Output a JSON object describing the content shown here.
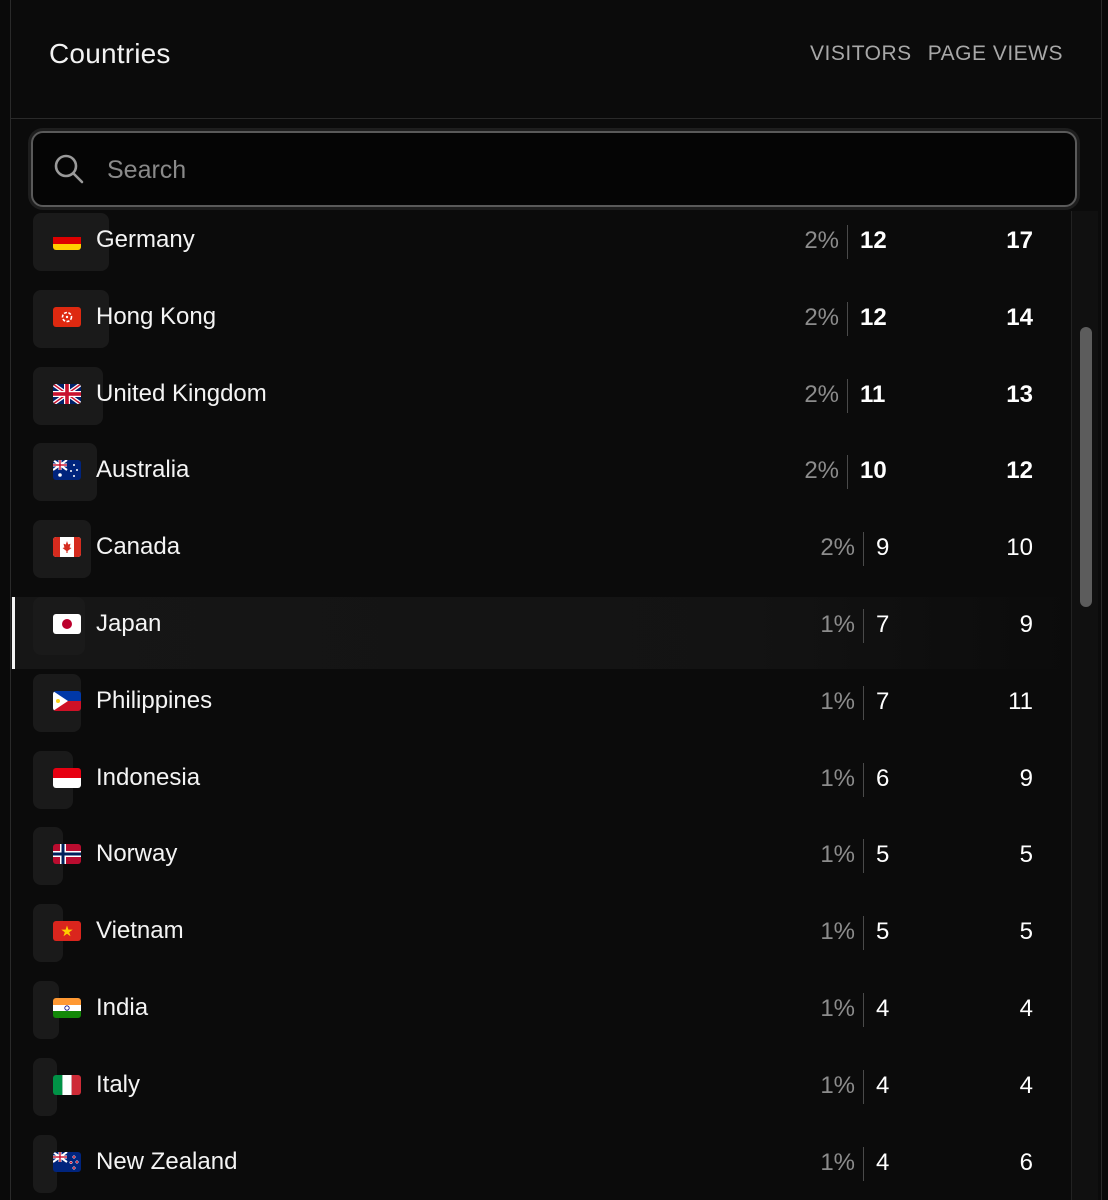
{
  "panel": {
    "title": "Countries",
    "columns": [
      "VISITORS",
      "PAGE VIEWS"
    ]
  },
  "search": {
    "placeholder": "Search",
    "value": ""
  },
  "colors": {
    "background": "#0b0b0b",
    "row_bar": "#1a1a1a",
    "text": "#f4f4f4",
    "muted": "#8c8c8c"
  },
  "rows": [
    {
      "country": "Germany",
      "flag": "germany-flag-icon",
      "percent": "2%",
      "percent_value": 2,
      "visitors": "12",
      "page_views": "17",
      "highlighted": false
    },
    {
      "country": "Hong Kong",
      "flag": "hong-kong-flag-icon",
      "percent": "2%",
      "percent_value": 2,
      "visitors": "12",
      "page_views": "14",
      "highlighted": false
    },
    {
      "country": "United Kingdom",
      "flag": "united-kingdom-flag-icon",
      "percent": "2%",
      "percent_value": 2,
      "visitors": "11",
      "page_views": "13",
      "highlighted": false
    },
    {
      "country": "Australia",
      "flag": "australia-flag-icon",
      "percent": "2%",
      "percent_value": 2,
      "visitors": "10",
      "page_views": "12",
      "highlighted": false
    },
    {
      "country": "Canada",
      "flag": "canada-flag-icon",
      "percent": "2%",
      "percent_value": 2,
      "visitors": "9",
      "page_views": "10",
      "highlighted": false
    },
    {
      "country": "Japan",
      "flag": "japan-flag-icon",
      "percent": "1%",
      "percent_value": 1,
      "visitors": "7",
      "page_views": "9",
      "highlighted": true
    },
    {
      "country": "Philippines",
      "flag": "philippines-flag-icon",
      "percent": "1%",
      "percent_value": 1,
      "visitors": "7",
      "page_views": "11",
      "highlighted": false
    },
    {
      "country": "Indonesia",
      "flag": "indonesia-flag-icon",
      "percent": "1%",
      "percent_value": 1,
      "visitors": "6",
      "page_views": "9",
      "highlighted": false
    },
    {
      "country": "Norway",
      "flag": "norway-flag-icon",
      "percent": "1%",
      "percent_value": 1,
      "visitors": "5",
      "page_views": "5",
      "highlighted": false
    },
    {
      "country": "Vietnam",
      "flag": "vietnam-flag-icon",
      "percent": "1%",
      "percent_value": 1,
      "visitors": "5",
      "page_views": "5",
      "highlighted": false
    },
    {
      "country": "India",
      "flag": "india-flag-icon",
      "percent": "1%",
      "percent_value": 1,
      "visitors": "4",
      "page_views": "4",
      "highlighted": false
    },
    {
      "country": "Italy",
      "flag": "italy-flag-icon",
      "percent": "1%",
      "percent_value": 1,
      "visitors": "4",
      "page_views": "4",
      "highlighted": false
    },
    {
      "country": "New Zealand",
      "flag": "new-zealand-flag-icon",
      "percent": "1%",
      "percent_value": 1,
      "visitors": "4",
      "page_views": "6",
      "highlighted": false
    }
  ]
}
